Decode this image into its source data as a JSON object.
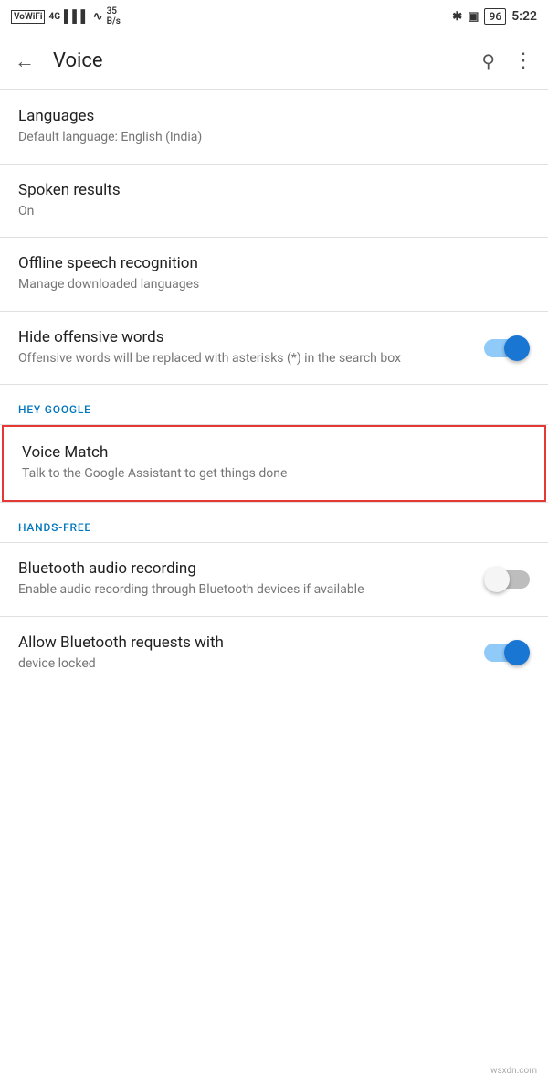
{
  "statusBar": {
    "left": {
      "wifi": "VoWiFi",
      "signal": "4G",
      "bars": "▌▌▌",
      "wifiSymbol": "⊙",
      "speed": "35 B/s"
    },
    "right": {
      "bluetooth": "✱",
      "vibrate": "📳",
      "battery": "96",
      "time": "5:22"
    }
  },
  "appBar": {
    "backLabel": "←",
    "title": "Voice",
    "searchIcon": "🔍",
    "moreIcon": "⋮"
  },
  "settings": {
    "languages": {
      "title": "Languages",
      "subtitle": "Default language: English (India)"
    },
    "spokenResults": {
      "title": "Spoken results",
      "subtitle": "On"
    },
    "offlineSpeech": {
      "title": "Offline speech recognition",
      "subtitle": "Manage downloaded languages"
    },
    "hideOffensive": {
      "title": "Hide offensive words",
      "subtitle": "Offensive words will be replaced with asterisks (*) in the search box",
      "toggleState": "on"
    },
    "heyGoogleSection": "HEY GOOGLE",
    "voiceMatch": {
      "title": "Voice Match",
      "subtitle": "Talk to the Google Assistant to get things done"
    },
    "handsFreeSection": "HANDS-FREE",
    "bluetoothAudio": {
      "title": "Bluetooth audio recording",
      "subtitle": "Enable audio recording through Bluetooth devices if available",
      "toggleState": "off"
    },
    "allowBluetooth": {
      "title": "Allow Bluetooth requests with",
      "subtitle": "device locked",
      "toggleState": "on"
    }
  }
}
